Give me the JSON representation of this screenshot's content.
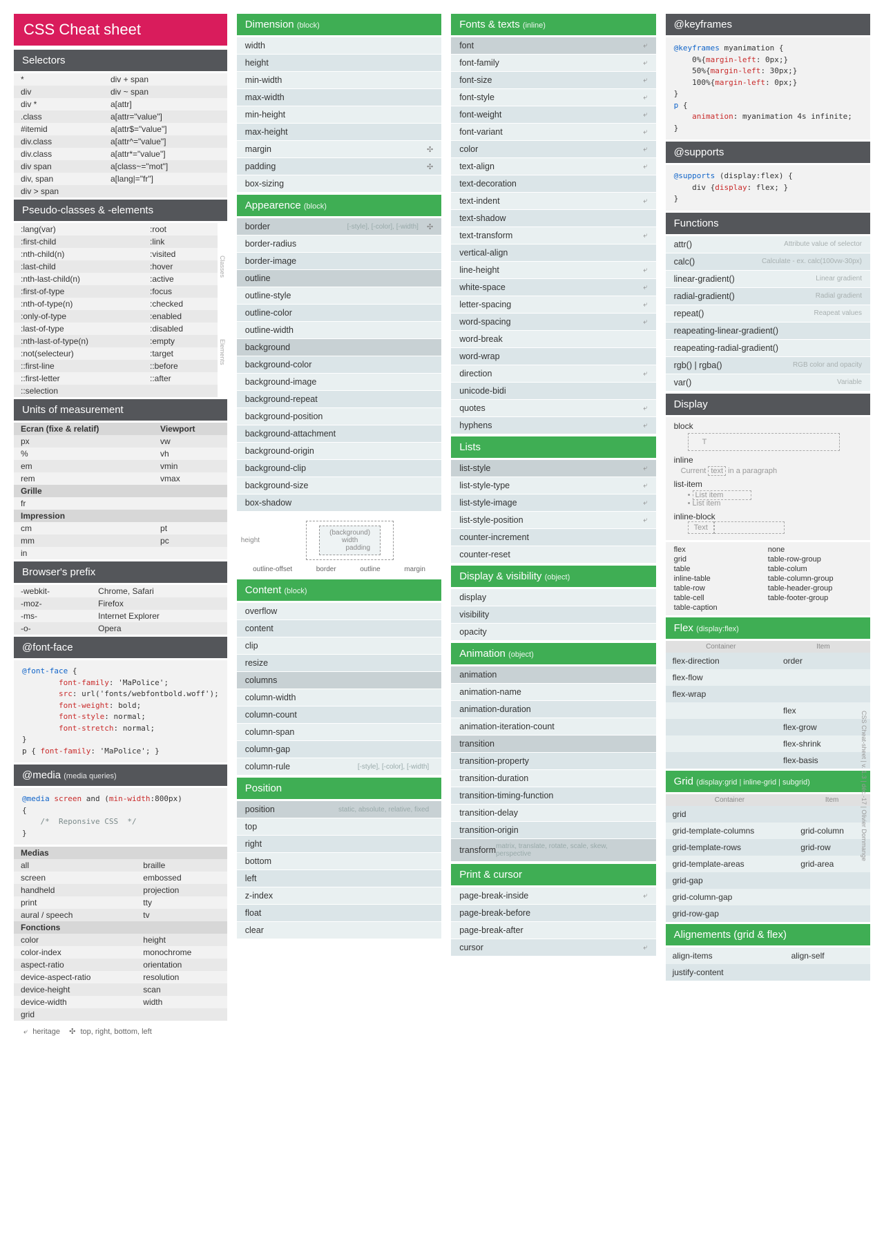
{
  "title": "CSS Cheat sheet",
  "legend": {
    "heritage": "heritage",
    "trbl": "top, right, bottom, left"
  },
  "footer": "CSS Cheat-sheet | v. 1.3 | déc.-17 | Olivier Dommange",
  "col1": {
    "selectors": {
      "title": "Selectors",
      "rows": [
        [
          "*",
          "div + span"
        ],
        [
          "div",
          "div ~ span"
        ],
        [
          "div *",
          "a[attr]"
        ],
        [
          ".class",
          "a[attr=\"value\"]"
        ],
        [
          "#itemid",
          "a[attr$=\"value\"]"
        ],
        [
          "div.class",
          "a[attr^=\"value\"]"
        ],
        [
          "div.class",
          "a[attr*=\"value\"]"
        ],
        [
          "div span",
          "a[class~=\"mot\"]"
        ],
        [
          "div, span",
          "a[lang|=\"fr\"]"
        ],
        [
          "div > span",
          ""
        ]
      ]
    },
    "pseudo": {
      "title": "Pseudo-classes & -elements",
      "rows": [
        [
          ":lang(var)",
          ":root"
        ],
        [
          ":first-child",
          ":link"
        ],
        [
          ":nth-child(n)",
          ":visited"
        ],
        [
          ":last-child",
          ":hover"
        ],
        [
          ":nth-last-child(n)",
          ":active"
        ],
        [
          ":first-of-type",
          ":focus"
        ],
        [
          ":nth-of-type(n)",
          ":checked"
        ],
        [
          ":only-of-type",
          ":enabled"
        ],
        [
          ":last-of-type",
          ":disabled"
        ],
        [
          ":nth-last-of-type(n)",
          ":empty"
        ],
        [
          ":not(selecteur)",
          ":target"
        ],
        [
          "::first-line",
          "::before"
        ],
        [
          "::first-letter",
          "::after"
        ],
        [
          "::selection",
          ""
        ]
      ],
      "side1": "Classes",
      "side2": "Elements"
    },
    "units": {
      "title": "Units of measurement",
      "h1": "Ecran (fixe & relatif)",
      "h1b": "Viewport",
      "r1": [
        [
          "px",
          "vw"
        ],
        [
          "%",
          "vh"
        ],
        [
          "em",
          "vmin"
        ],
        [
          "rem",
          "vmax"
        ]
      ],
      "h2": "Grille",
      "r2": [
        [
          "fr",
          ""
        ]
      ],
      "h3": "Impression",
      "r3": [
        [
          "cm",
          "pt"
        ],
        [
          "mm",
          "pc"
        ],
        [
          "in",
          ""
        ]
      ]
    },
    "prefix": {
      "title": "Browser's prefix",
      "rows": [
        [
          "-webkit-",
          "Chrome, Safari"
        ],
        [
          "-moz-",
          "Firefox"
        ],
        [
          "-ms-",
          "Internet Explorer"
        ],
        [
          "-o-",
          "Opera"
        ]
      ]
    },
    "fontface": {
      "title": "@font-face"
    },
    "media": {
      "title": "@media",
      "sub": "(media queries)",
      "h1": "Medias",
      "r1": [
        [
          "all",
          "braille"
        ],
        [
          "screen",
          "embossed"
        ],
        [
          "handheld",
          "projection"
        ],
        [
          "print",
          "tty"
        ],
        [
          "aural / speech",
          "tv"
        ]
      ],
      "h2": "Fonctions",
      "r2": [
        [
          "color",
          "height"
        ],
        [
          "color-index",
          "monochrome"
        ],
        [
          "aspect-ratio",
          "orientation"
        ],
        [
          "device-aspect-ratio",
          "resolution"
        ],
        [
          "device-height",
          "scan"
        ],
        [
          "device-width",
          "width"
        ],
        [
          "grid",
          ""
        ]
      ]
    }
  },
  "col2": {
    "dimension": {
      "title": "Dimension",
      "sub": "(block)",
      "items": [
        {
          "n": "width"
        },
        {
          "n": "height"
        },
        {
          "n": "min-width"
        },
        {
          "n": "max-width"
        },
        {
          "n": "min-height"
        },
        {
          "n": "max-height"
        },
        {
          "n": "margin",
          "trbl": true
        },
        {
          "n": "padding",
          "trbl": true
        },
        {
          "n": "box-sizing"
        }
      ]
    },
    "appearance": {
      "title": "Appearence",
      "sub": "(block)",
      "items": [
        {
          "n": "border",
          "hint": "[-style], [-color], [-width]",
          "trbl": true,
          "hl": true
        },
        {
          "n": "border-radius"
        },
        {
          "n": "border-image"
        },
        {
          "n": "outline",
          "hl": true
        },
        {
          "n": "outline-style"
        },
        {
          "n": "outline-color"
        },
        {
          "n": "outline-width"
        },
        {
          "n": "background",
          "hl": true
        },
        {
          "n": "background-color"
        },
        {
          "n": "background-image"
        },
        {
          "n": "background-repeat"
        },
        {
          "n": "background-position"
        },
        {
          "n": "background-attachment"
        },
        {
          "n": "background-origin"
        },
        {
          "n": "background-clip"
        },
        {
          "n": "background-size"
        },
        {
          "n": "box-shadow"
        }
      ]
    },
    "diagram": {
      "bg": "(background)",
      "width": "width",
      "pad": "padding",
      "height": "height",
      "labels": [
        "outline-offset",
        "border",
        "outline",
        "margin"
      ]
    },
    "content": {
      "title": "Content",
      "sub": "(block)",
      "items": [
        {
          "n": "overflow"
        },
        {
          "n": "content"
        },
        {
          "n": "clip"
        },
        {
          "n": "resize"
        },
        {
          "n": "columns",
          "hl": true
        },
        {
          "n": "column-width"
        },
        {
          "n": "column-count"
        },
        {
          "n": "column-span"
        },
        {
          "n": "column-gap"
        },
        {
          "n": "column-rule",
          "hint": "[-style], [-color], [-width]"
        }
      ]
    },
    "position": {
      "title": "Position",
      "items": [
        {
          "n": "position",
          "hint": "static, absolute, relative, fixed",
          "hl": true
        },
        {
          "n": "top"
        },
        {
          "n": "right"
        },
        {
          "n": "bottom"
        },
        {
          "n": "left"
        },
        {
          "n": "z-index"
        },
        {
          "n": "float"
        },
        {
          "n": "clear"
        }
      ]
    }
  },
  "col3": {
    "fonts": {
      "title": "Fonts & texts",
      "sub": "(inline)",
      "items": [
        {
          "n": "font",
          "her": true,
          "hl": true
        },
        {
          "n": "font-family",
          "her": true
        },
        {
          "n": "font-size",
          "her": true
        },
        {
          "n": "font-style",
          "her": true
        },
        {
          "n": "font-weight",
          "her": true
        },
        {
          "n": "font-variant",
          "her": true
        },
        {
          "n": "color",
          "her": true
        },
        {
          "n": "text-align",
          "her": true
        },
        {
          "n": "text-decoration"
        },
        {
          "n": "text-indent",
          "her": true
        },
        {
          "n": "text-shadow"
        },
        {
          "n": "text-transform",
          "her": true
        },
        {
          "n": "vertical-align"
        },
        {
          "n": "line-height",
          "her": true
        },
        {
          "n": "white-space",
          "her": true
        },
        {
          "n": "letter-spacing",
          "her": true
        },
        {
          "n": "word-spacing",
          "her": true
        },
        {
          "n": "word-break"
        },
        {
          "n": "word-wrap"
        },
        {
          "n": "direction",
          "her": true
        },
        {
          "n": "unicode-bidi"
        },
        {
          "n": "quotes",
          "her": true
        },
        {
          "n": "hyphens",
          "her": true
        }
      ]
    },
    "lists": {
      "title": "Lists",
      "items": [
        {
          "n": "list-style",
          "her": true,
          "hl": true
        },
        {
          "n": "list-style-type",
          "her": true
        },
        {
          "n": "list-style-image",
          "her": true
        },
        {
          "n": "list-style-position",
          "her": true
        },
        {
          "n": "counter-increment"
        },
        {
          "n": "counter-reset"
        }
      ]
    },
    "display": {
      "title": "Display & visibility",
      "sub": "(object)",
      "items": [
        {
          "n": "display"
        },
        {
          "n": "visibility"
        },
        {
          "n": "opacity"
        }
      ]
    },
    "animation": {
      "title": "Animation",
      "sub": "(object)",
      "items": [
        {
          "n": "animation",
          "hl": true
        },
        {
          "n": "animation-name"
        },
        {
          "n": "animation-duration"
        },
        {
          "n": "animation-iteration-count"
        },
        {
          "n": "transition",
          "hl": true
        },
        {
          "n": "transition-property"
        },
        {
          "n": "transition-duration"
        },
        {
          "n": "transition-timing-function"
        },
        {
          "n": "transition-delay"
        },
        {
          "n": "transition-origin"
        },
        {
          "n": "transform",
          "hint": "matrix, translate, rotate, scale, skew, perspective",
          "hl": true
        }
      ]
    },
    "print": {
      "title": "Print & cursor",
      "items": [
        {
          "n": "page-break-inside",
          "her": true
        },
        {
          "n": "page-break-before"
        },
        {
          "n": "page-break-after"
        },
        {
          "n": "cursor",
          "her": true
        }
      ]
    }
  },
  "col4": {
    "keyframes": {
      "title": "@keyframes"
    },
    "supports": {
      "title": "@supports"
    },
    "functions": {
      "title": "Functions",
      "rows": [
        [
          "attr()",
          "Attribute value of selector"
        ],
        [
          "calc()",
          "Calculate - ex. calc(100vw-30px)"
        ],
        [
          "linear-gradient()",
          "Linear gradient"
        ],
        [
          "radial-gradient()",
          "Radial gradient"
        ],
        [
          "repeat()",
          "Reapeat values"
        ],
        [
          "reapeating-linear-gradient()",
          ""
        ],
        [
          "reapeating-radial-gradient()",
          ""
        ],
        [
          "rgb() | rgba()",
          "RGB color and opacity"
        ],
        [
          "var()",
          "Variable"
        ]
      ]
    },
    "displaySec": {
      "title": "Display",
      "block": "block",
      "blockT": "T",
      "inline": "inline",
      "inlineT": "Current text in a paragraph",
      "listitem": "list-item",
      "li1": "List item",
      "li2": "List item",
      "inlineblock": "inline-block",
      "ib": "Text",
      "valuesL": [
        "flex",
        "grid",
        "table",
        "inline-table",
        "table-row",
        "table-cell",
        "table-caption"
      ],
      "valuesR": [
        "none",
        "table-row-group",
        "table-colum",
        "table-column-group",
        "table-header-group",
        "table-footer-group"
      ]
    },
    "flex": {
      "title": "Flex",
      "sub": "(display:flex)",
      "hc": "Container",
      "hi": "Item",
      "rows": [
        [
          "flex-direction",
          "order"
        ],
        [
          "flex-flow",
          ""
        ],
        [
          "flex-wrap",
          ""
        ],
        [
          "",
          "flex"
        ],
        [
          "",
          "flex-grow"
        ],
        [
          "",
          "flex-shrink"
        ],
        [
          "",
          "flex-basis"
        ]
      ]
    },
    "grid": {
      "title": "Grid",
      "sub": "(display:grid | inline-grid | subgrid)",
      "hc": "Container",
      "hi": "Item",
      "rows": [
        [
          "grid",
          ""
        ],
        [
          "grid-template-columns",
          "grid-column"
        ],
        [
          "grid-template-rows",
          "grid-row"
        ],
        [
          "grid-template-areas",
          "grid-area"
        ],
        [
          "grid-gap",
          ""
        ],
        [
          "grid-column-gap",
          ""
        ],
        [
          "grid-row-gap",
          ""
        ]
      ]
    },
    "align": {
      "title": "Alignements (grid & flex)",
      "rows": [
        [
          "align-items",
          "align-self"
        ],
        [
          "justify-content",
          ""
        ]
      ]
    }
  }
}
